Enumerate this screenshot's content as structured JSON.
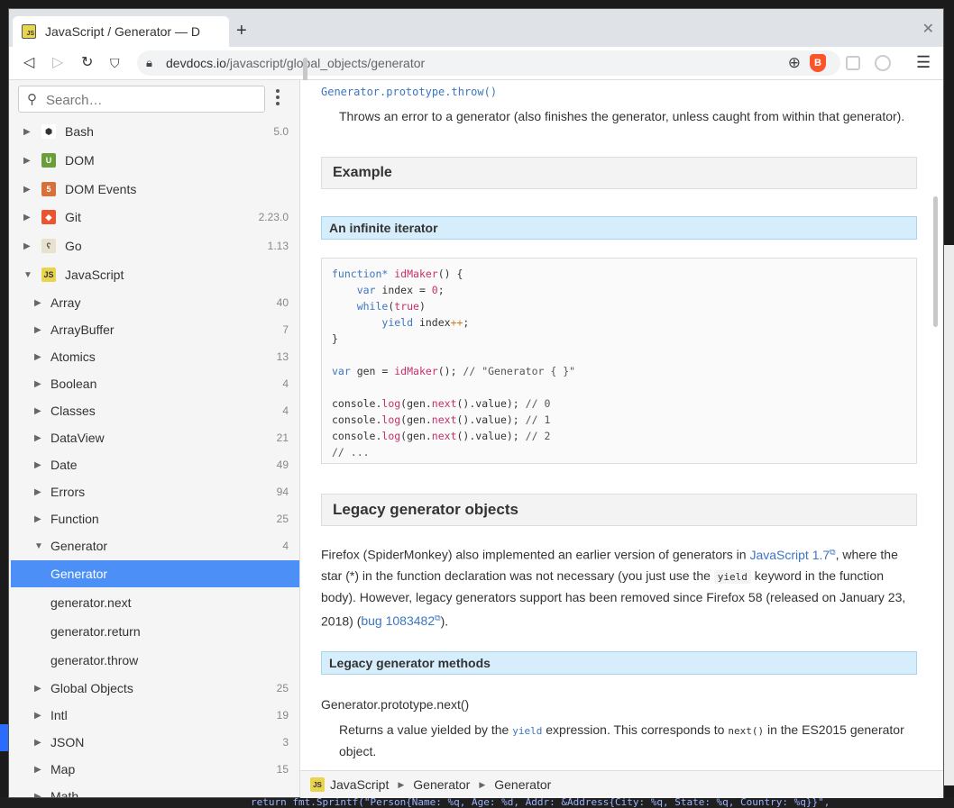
{
  "browser": {
    "tab_title": "JavaScript / Generator — D",
    "favicon_text": "JS",
    "url_host": "devdocs.io",
    "url_path": "/javascript/global_objects/generator",
    "brave_label": "B"
  },
  "sidebar": {
    "search_placeholder": "Search…",
    "items": [
      {
        "label": "Bash",
        "count": "5.0"
      },
      {
        "label": "DOM",
        "count": ""
      },
      {
        "label": "DOM Events",
        "count": ""
      },
      {
        "label": "Git",
        "count": "2.23.0"
      },
      {
        "label": "Go",
        "count": "1.13"
      },
      {
        "label": "JavaScript",
        "count": ""
      },
      {
        "label": "Array",
        "count": "40"
      },
      {
        "label": "ArrayBuffer",
        "count": "7"
      },
      {
        "label": "Atomics",
        "count": "13"
      },
      {
        "label": "Boolean",
        "count": "4"
      },
      {
        "label": "Classes",
        "count": "4"
      },
      {
        "label": "DataView",
        "count": "21"
      },
      {
        "label": "Date",
        "count": "49"
      },
      {
        "label": "Errors",
        "count": "94"
      },
      {
        "label": "Function",
        "count": "25"
      },
      {
        "label": "Generator",
        "count": "4"
      },
      {
        "label": "Generator",
        "count": ""
      },
      {
        "label": "generator.next",
        "count": ""
      },
      {
        "label": "generator.return",
        "count": ""
      },
      {
        "label": "generator.throw",
        "count": ""
      },
      {
        "label": "Global Objects",
        "count": "25"
      },
      {
        "label": "Intl",
        "count": "19"
      },
      {
        "label": "JSON",
        "count": "3"
      },
      {
        "label": "Map",
        "count": "15"
      },
      {
        "label": "Math",
        "count": ""
      }
    ]
  },
  "content": {
    "throw_sig": "Generator.prototype.throw()",
    "throw_desc": "Throws an error to a generator (also finishes the generator, unless caught from within that generator).",
    "h_example": "Example",
    "h_infinite": "An infinite iterator",
    "h_legacy_objects": "Legacy generator objects",
    "legacy_p1": "Firefox (SpiderMonkey) also implemented an earlier version of generators in",
    "legacy_link1": "JavaScript 1.7",
    "legacy_p2": ", where the star (*) in the function declaration was not necessary (you just use the",
    "legacy_yield": "yield",
    "legacy_p3": "keyword in the function body). However, legacy generators support has been removed since Firefox 58 (released on January 23, 2018) (",
    "legacy_link2": "bug 1083482",
    "legacy_p4": ").",
    "h_legacy_methods": "Legacy generator methods",
    "next_sig": "Generator.prototype.next()",
    "next_p1": "Returns a value yielded by the",
    "next_yield": "yield",
    "next_p2": "expression. This corresponds to",
    "next_code": "next()",
    "next_p3": "in the ES2015 generator object."
  },
  "code_lines": [
    "function* idMaker() {",
    "    var index = 0;",
    "    while(true)",
    "        yield index++;",
    "}",
    "",
    "var gen = idMaker(); // \"Generator { }\"",
    "",
    "console.log(gen.next().value); // 0",
    "console.log(gen.next().value); // 1",
    "console.log(gen.next().value); // 2",
    "// ..."
  ],
  "breadcrumb": [
    "JavaScript",
    "Generator",
    "Generator"
  ],
  "background_text": "return fmt.Sprintf(\"Person{Name: %q, Age: %d, Addr: &Address{City: %q, State: %q, Country: %q}}\","
}
